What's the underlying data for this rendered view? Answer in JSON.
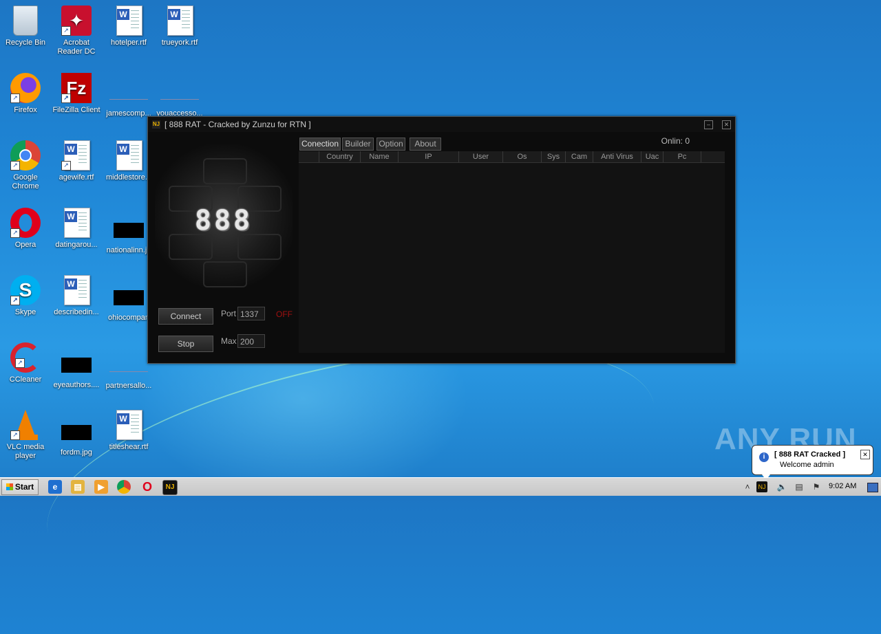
{
  "desktop": {
    "icons": [
      {
        "label": "Recycle Bin"
      },
      {
        "label": "Acrobat Reader DC"
      },
      {
        "label": "hotelper.rtf"
      },
      {
        "label": "trueyork.rtf"
      },
      {
        "label": "Firefox"
      },
      {
        "label": "FileZilla Client"
      },
      {
        "label": "jamescomp..."
      },
      {
        "label": "youaccesso..."
      },
      {
        "label": "Google Chrome"
      },
      {
        "label": "agewife.rtf"
      },
      {
        "label": "middlestore..."
      },
      {
        "label": "Opera"
      },
      {
        "label": "datingarou..."
      },
      {
        "label": "nationalinn.jp"
      },
      {
        "label": "Skype"
      },
      {
        "label": "describedin..."
      },
      {
        "label": "ohiocompan"
      },
      {
        "label": "CCleaner"
      },
      {
        "label": "eyeauthors...."
      },
      {
        "label": "partnersallo..."
      },
      {
        "label": "VLC media player"
      },
      {
        "label": "fordm.jpg"
      },
      {
        "label": "titleshear.rtf"
      }
    ]
  },
  "window": {
    "title": "[ 888 RAT - Cracked by Zunzu for RTN ]",
    "logo_text": "888",
    "connect_label": "Connect",
    "stop_label": "Stop",
    "port_label": "Port",
    "port_value": "1337",
    "status_text": "OFF",
    "max_label": "Max",
    "max_value": "200",
    "online_label": "Onlin:",
    "online_count": "0",
    "tabs": [
      {
        "label": "Conection"
      },
      {
        "label": "Builder"
      },
      {
        "label": "Option"
      },
      {
        "label": "About"
      }
    ],
    "columns": [
      "",
      "Country",
      "Name",
      "IP",
      "User",
      "Os",
      "Sys",
      "Cam",
      "Anti Virus",
      "Uac",
      "Pc",
      ""
    ]
  },
  "taskbar": {
    "start_label": "Start",
    "clock": "9:02 AM"
  },
  "notification": {
    "title": "[ 888 RAT Cracked ]",
    "message": "Welcome admin"
  },
  "watermark": "ANY RUN"
}
